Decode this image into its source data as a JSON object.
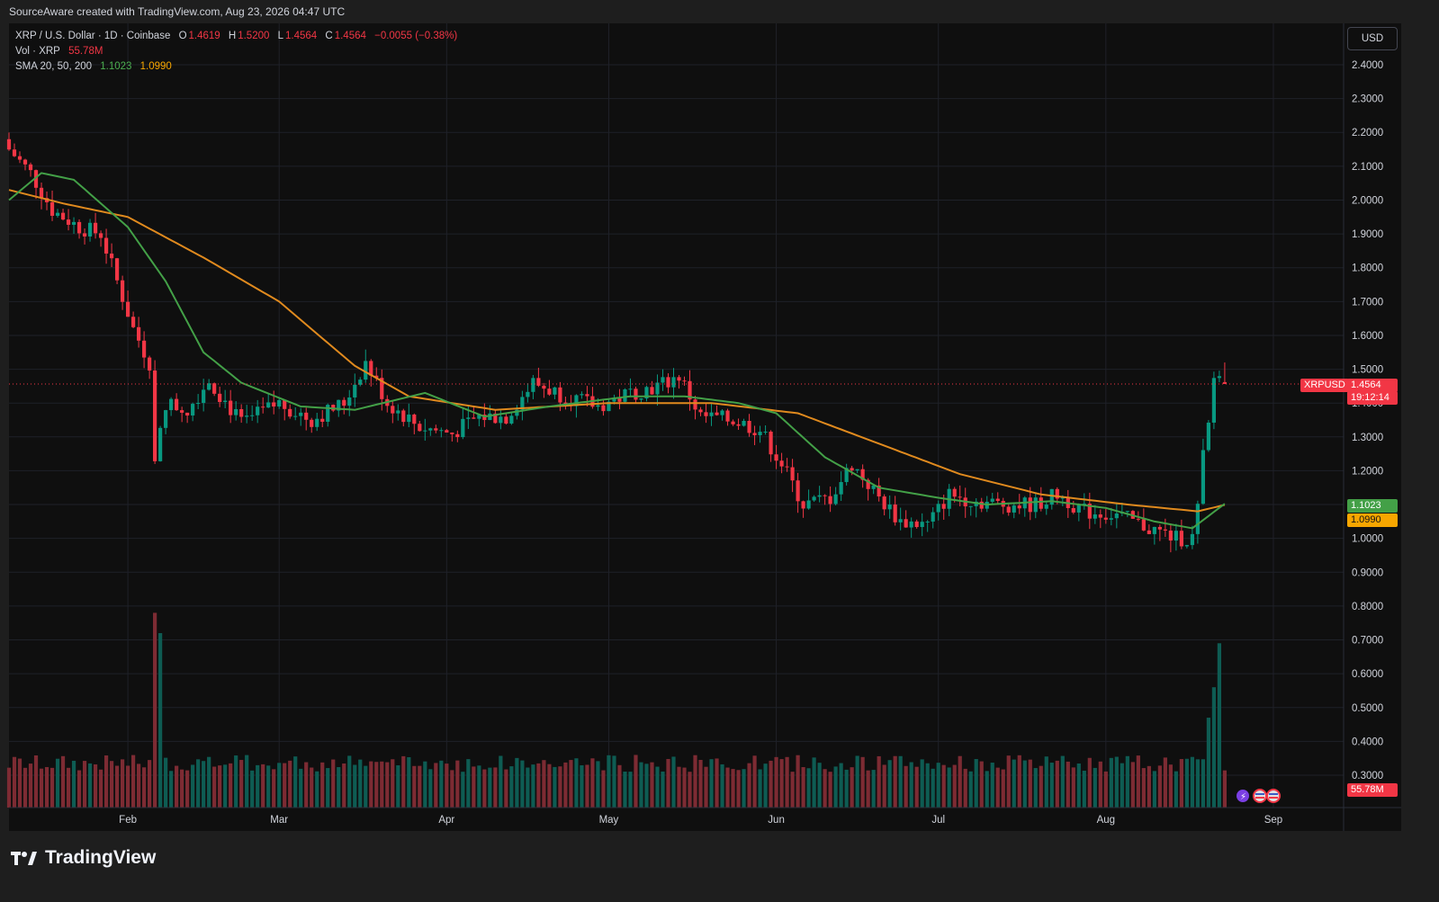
{
  "header": {
    "caption": "SourceAware created with TradingView.com, Aug 23, 2026 04:47 UTC"
  },
  "legend": {
    "symbol": "XRP / U.S. Dollar · 1D · Coinbase",
    "o_label": "O",
    "o_value": "1.4619",
    "h_label": "H",
    "h_value": "1.5200",
    "l_label": "L",
    "l_value": "1.4564",
    "c_label": "C",
    "c_value": "1.4564",
    "change": "−0.0055 (−0.38%)",
    "vol_label": "Vol · XRP",
    "vol_value": "55.78M",
    "sma_label": "SMA 20, 50, 200",
    "sma20": "1.1023",
    "sma50": "1.0990"
  },
  "currency_button": "USD",
  "brand": {
    "name": "TradingView"
  },
  "badges": {
    "symbol": "XRPUSD",
    "price": "1.4564",
    "countdown": "19:12:14",
    "sma20": "1.1023",
    "sma50": "1.0990",
    "volume": "55.78M"
  },
  "colors": {
    "up": "#089981",
    "down": "#f23645",
    "sma20": "#43a047",
    "sma50": "#e08a1e",
    "vol_up": "#0e5c53",
    "vol_down": "#7d2b33",
    "background": "#0f0f0f"
  },
  "chart_data": {
    "type": "candlestick",
    "symbol": "XRP / U.S. Dollar",
    "interval": "1D",
    "exchange": "Coinbase",
    "y_axis": {
      "range": [
        0.26,
        2.46
      ],
      "ticks": [
        "2.4000",
        "2.3000",
        "2.2000",
        "2.1000",
        "2.0000",
        "1.9000",
        "1.8000",
        "1.7000",
        "1.6000",
        "1.5000",
        "1.4000",
        "1.3000",
        "1.2000",
        "1.1000",
        "1.0000",
        "0.9000",
        "0.8000",
        "0.7000",
        "0.6000",
        "0.5000",
        "0.4000",
        "0.3000"
      ]
    },
    "x_axis": {
      "start": "2026-01-10",
      "end": "2026-09-14",
      "ticks": [
        {
          "label": "Feb",
          "date": "2026-02-01"
        },
        {
          "label": "Mar",
          "date": "2026-03-01"
        },
        {
          "label": "Apr",
          "date": "2026-04-01"
        },
        {
          "label": "May",
          "date": "2026-05-01"
        },
        {
          "label": "Jun",
          "date": "2026-06-01"
        },
        {
          "label": "Jul",
          "date": "2026-07-01"
        },
        {
          "label": "Aug",
          "date": "2026-08-01"
        },
        {
          "label": "Sep",
          "date": "2026-09-01"
        }
      ]
    },
    "current_price": 1.4564,
    "sma20_last": 1.1023,
    "sma50_last": 1.099,
    "close_anchors": [
      {
        "date": "2026-01-10",
        "close": 2.15
      },
      {
        "date": "2026-01-14",
        "close": 2.08
      },
      {
        "date": "2026-01-18",
        "close": 1.97
      },
      {
        "date": "2026-01-23",
        "close": 1.92
      },
      {
        "date": "2026-01-27",
        "close": 1.9
      },
      {
        "date": "2026-01-30",
        "close": 1.76
      },
      {
        "date": "2026-02-02",
        "close": 1.62
      },
      {
        "date": "2026-02-05",
        "close": 1.52
      },
      {
        "date": "2026-02-06",
        "close": 1.22
      },
      {
        "date": "2026-02-08",
        "close": 1.4
      },
      {
        "date": "2026-02-12",
        "close": 1.38
      },
      {
        "date": "2026-02-16",
        "close": 1.47
      },
      {
        "date": "2026-02-22",
        "close": 1.34
      },
      {
        "date": "2026-03-01",
        "close": 1.4
      },
      {
        "date": "2026-03-07",
        "close": 1.35
      },
      {
        "date": "2026-03-13",
        "close": 1.4
      },
      {
        "date": "2026-03-17",
        "close": 1.52
      },
      {
        "date": "2026-03-21",
        "close": 1.4
      },
      {
        "date": "2026-03-27",
        "close": 1.33
      },
      {
        "date": "2026-04-02",
        "close": 1.31
      },
      {
        "date": "2026-04-07",
        "close": 1.36
      },
      {
        "date": "2026-04-12",
        "close": 1.36
      },
      {
        "date": "2026-04-17",
        "close": 1.46
      },
      {
        "date": "2026-04-23",
        "close": 1.42
      },
      {
        "date": "2026-04-29",
        "close": 1.39
      },
      {
        "date": "2026-05-05",
        "close": 1.43
      },
      {
        "date": "2026-05-10",
        "close": 1.45
      },
      {
        "date": "2026-05-14",
        "close": 1.48
      },
      {
        "date": "2026-05-18",
        "close": 1.36
      },
      {
        "date": "2026-05-24",
        "close": 1.35
      },
      {
        "date": "2026-05-29",
        "close": 1.32
      },
      {
        "date": "2026-06-02",
        "close": 1.22
      },
      {
        "date": "2026-06-06",
        "close": 1.1
      },
      {
        "date": "2026-06-11",
        "close": 1.12
      },
      {
        "date": "2026-06-15",
        "close": 1.22
      },
      {
        "date": "2026-06-20",
        "close": 1.12
      },
      {
        "date": "2026-06-24",
        "close": 1.05
      },
      {
        "date": "2026-06-29",
        "close": 1.04
      },
      {
        "date": "2026-07-03",
        "close": 1.13
      },
      {
        "date": "2026-07-08",
        "close": 1.11
      },
      {
        "date": "2026-07-13",
        "close": 1.1
      },
      {
        "date": "2026-07-19",
        "close": 1.1
      },
      {
        "date": "2026-07-23",
        "close": 1.13
      },
      {
        "date": "2026-07-28",
        "close": 1.08
      },
      {
        "date": "2026-08-03",
        "close": 1.07
      },
      {
        "date": "2026-08-09",
        "close": 1.03
      },
      {
        "date": "2026-08-14",
        "close": 1.0
      },
      {
        "date": "2026-08-17",
        "close": 1.0
      },
      {
        "date": "2026-08-18",
        "close": 1.09
      },
      {
        "date": "2026-08-19",
        "close": 1.24
      },
      {
        "date": "2026-08-20",
        "close": 1.33
      },
      {
        "date": "2026-08-21",
        "close": 1.47
      },
      {
        "date": "2026-08-22",
        "close": 1.46
      },
      {
        "date": "2026-08-23",
        "close": 1.4564
      }
    ],
    "sma20_anchors": [
      {
        "date": "2026-01-10",
        "value": 2.0
      },
      {
        "date": "2026-01-16",
        "value": 2.08
      },
      {
        "date": "2026-01-22",
        "value": 2.06
      },
      {
        "date": "2026-02-01",
        "value": 1.92
      },
      {
        "date": "2026-02-08",
        "value": 1.76
      },
      {
        "date": "2026-02-15",
        "value": 1.55
      },
      {
        "date": "2026-02-22",
        "value": 1.46
      },
      {
        "date": "2026-03-05",
        "value": 1.39
      },
      {
        "date": "2026-03-15",
        "value": 1.38
      },
      {
        "date": "2026-03-28",
        "value": 1.43
      },
      {
        "date": "2026-04-08",
        "value": 1.36
      },
      {
        "date": "2026-04-20",
        "value": 1.39
      },
      {
        "date": "2026-05-05",
        "value": 1.42
      },
      {
        "date": "2026-05-15",
        "value": 1.42
      },
      {
        "date": "2026-05-25",
        "value": 1.4
      },
      {
        "date": "2026-06-01",
        "value": 1.37
      },
      {
        "date": "2026-06-10",
        "value": 1.24
      },
      {
        "date": "2026-06-20",
        "value": 1.15
      },
      {
        "date": "2026-07-01",
        "value": 1.12
      },
      {
        "date": "2026-07-10",
        "value": 1.1
      },
      {
        "date": "2026-07-22",
        "value": 1.11
      },
      {
        "date": "2026-08-01",
        "value": 1.09
      },
      {
        "date": "2026-08-10",
        "value": 1.05
      },
      {
        "date": "2026-08-17",
        "value": 1.03
      },
      {
        "date": "2026-08-23",
        "value": 1.1023
      }
    ],
    "sma50_anchors": [
      {
        "date": "2026-01-10",
        "value": 2.03
      },
      {
        "date": "2026-01-20",
        "value": 1.99
      },
      {
        "date": "2026-02-01",
        "value": 1.95
      },
      {
        "date": "2026-02-15",
        "value": 1.83
      },
      {
        "date": "2026-03-01",
        "value": 1.7
      },
      {
        "date": "2026-03-15",
        "value": 1.51
      },
      {
        "date": "2026-03-25",
        "value": 1.42
      },
      {
        "date": "2026-04-10",
        "value": 1.38
      },
      {
        "date": "2026-05-01",
        "value": 1.4
      },
      {
        "date": "2026-05-20",
        "value": 1.4
      },
      {
        "date": "2026-06-05",
        "value": 1.37
      },
      {
        "date": "2026-06-20",
        "value": 1.28
      },
      {
        "date": "2026-07-05",
        "value": 1.19
      },
      {
        "date": "2026-07-20",
        "value": 1.13
      },
      {
        "date": "2026-08-05",
        "value": 1.1
      },
      {
        "date": "2026-08-18",
        "value": 1.08
      },
      {
        "date": "2026-08-23",
        "value": 1.099
      }
    ],
    "volume_last": "55.78M",
    "volume_spikes": [
      {
        "date": "2026-02-06",
        "level": 0.78
      },
      {
        "date": "2026-02-07",
        "level": 0.72
      },
      {
        "date": "2026-08-20",
        "level": 0.47
      },
      {
        "date": "2026-08-21",
        "level": 0.56
      },
      {
        "date": "2026-08-22",
        "level": 0.69
      }
    ]
  }
}
